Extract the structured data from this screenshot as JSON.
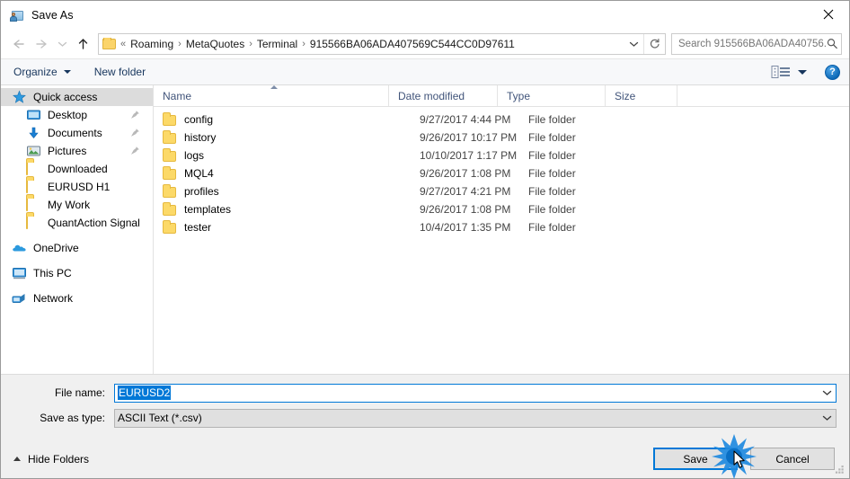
{
  "window": {
    "title": "Save As",
    "title_icon": "save-as-user-folder-icon",
    "close_icon": "close-icon"
  },
  "nav": {
    "back_icon": "arrow-left-icon",
    "forward_icon": "arrow-right-icon",
    "recent_icon": "chevron-down-icon",
    "up_icon": "arrow-up-icon",
    "breadcrumb_folder_icon": "folder-icon",
    "breadcrumb_prefix": "«",
    "crumbs": [
      "Roaming",
      "MetaQuotes",
      "Terminal",
      "915566BA06ADA407569C544CC0D97611"
    ],
    "separator": "›",
    "dropdown_icon": "chevron-down-icon",
    "refresh_icon": "refresh-icon"
  },
  "search": {
    "placeholder": "Search 915566BA06ADA40756...",
    "icon": "search-icon"
  },
  "toolbar": {
    "organize_label": "Organize",
    "new_folder_label": "New folder",
    "view_icon": "view-layout-icon",
    "view_caret_icon": "chevron-down-icon",
    "help_label": "?",
    "help_icon": "help-icon"
  },
  "sidebar": {
    "items": [
      {
        "label": "Quick access",
        "icon": "star-icon",
        "indent": false,
        "selected": true,
        "pinned": false,
        "gap": false
      },
      {
        "label": "Desktop",
        "icon": "desktop-icon",
        "indent": true,
        "selected": false,
        "pinned": true,
        "gap": false
      },
      {
        "label": "Documents",
        "icon": "download-icon",
        "indent": true,
        "selected": false,
        "pinned": true,
        "gap": false
      },
      {
        "label": "Pictures",
        "icon": "pictures-icon",
        "indent": true,
        "selected": false,
        "pinned": true,
        "gap": false
      },
      {
        "label": "Downloaded",
        "icon": "folder-icon",
        "indent": true,
        "selected": false,
        "pinned": false,
        "gap": false
      },
      {
        "label": "EURUSD H1",
        "icon": "folder-icon",
        "indent": true,
        "selected": false,
        "pinned": false,
        "gap": false
      },
      {
        "label": "My Work",
        "icon": "folder-icon",
        "indent": true,
        "selected": false,
        "pinned": false,
        "gap": false
      },
      {
        "label": "QuantAction Signal",
        "icon": "folder-icon",
        "indent": true,
        "selected": false,
        "pinned": false,
        "gap": false
      },
      {
        "label": "OneDrive",
        "icon": "cloud-icon",
        "indent": false,
        "selected": false,
        "pinned": false,
        "gap": true
      },
      {
        "label": "This PC",
        "icon": "computer-icon",
        "indent": false,
        "selected": false,
        "pinned": false,
        "gap": true
      },
      {
        "label": "Network",
        "icon": "network-icon",
        "indent": false,
        "selected": false,
        "pinned": false,
        "gap": true
      }
    ]
  },
  "filelist": {
    "columns": [
      "Name",
      "Date modified",
      "Type",
      "Size"
    ],
    "sort_column": "Name",
    "sort_direction": "ascending",
    "rows": [
      {
        "name": "config",
        "date": "9/27/2017 4:44 PM",
        "type": "File folder",
        "size": ""
      },
      {
        "name": "history",
        "date": "9/26/2017 10:17 PM",
        "type": "File folder",
        "size": ""
      },
      {
        "name": "logs",
        "date": "10/10/2017 1:17 PM",
        "type": "File folder",
        "size": ""
      },
      {
        "name": "MQL4",
        "date": "9/26/2017 1:08 PM",
        "type": "File folder",
        "size": ""
      },
      {
        "name": "profiles",
        "date": "9/27/2017 4:21 PM",
        "type": "File folder",
        "size": ""
      },
      {
        "name": "templates",
        "date": "9/26/2017 1:08 PM",
        "type": "File folder",
        "size": ""
      },
      {
        "name": "tester",
        "date": "10/4/2017 1:35 PM",
        "type": "File folder",
        "size": ""
      }
    ]
  },
  "fields": {
    "file_name_label": "File name:",
    "file_name_value": "EURUSD2",
    "save_as_type_label": "Save as type:",
    "save_as_type_value": "ASCII Text (*.csv)",
    "dropdown_icon": "chevron-down-icon"
  },
  "footer": {
    "hide_folders_label": "Hide Folders",
    "hide_folders_icon": "chevron-up-icon",
    "save_label": "Save",
    "cancel_label": "Cancel",
    "resize_grip_icon": "resize-grip-icon",
    "cursor_icon": "mouse-pointer-icon",
    "click_effect_icon": "click-burst-icon"
  },
  "colors": {
    "accent": "#0078d7",
    "folder": "#fcd968",
    "toolbar_text": "#17365d",
    "header_text": "#41547a",
    "selection": "#dcdcdc"
  }
}
